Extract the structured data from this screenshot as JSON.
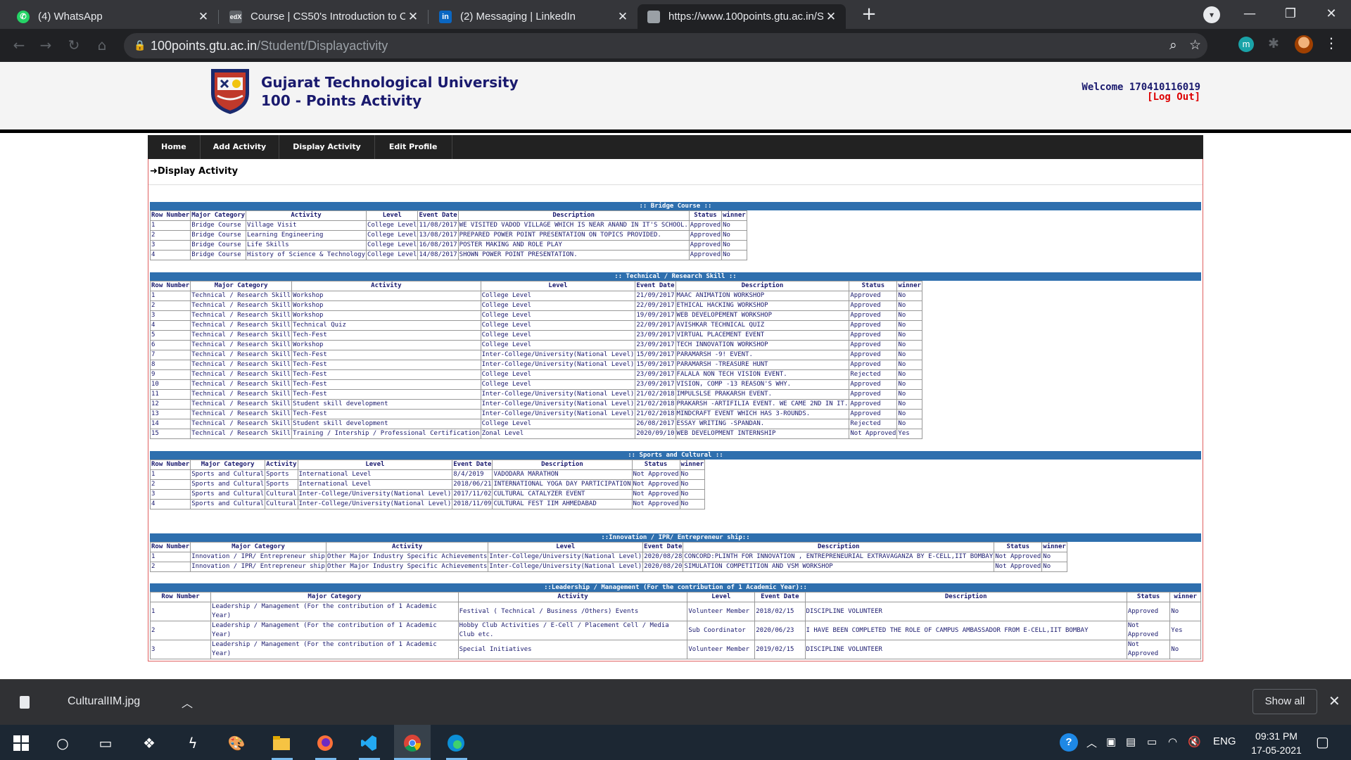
{
  "browser": {
    "tabs": [
      {
        "title": "(4) WhatsApp",
        "icon": "whatsapp-icon",
        "color": "#25d366"
      },
      {
        "title": "Course | CS50's Introduction to C",
        "icon": "edx-icon",
        "color": "#5f6368"
      },
      {
        "title": "(2) Messaging | LinkedIn",
        "icon": "linkedin-icon",
        "color": "#0a66c2"
      },
      {
        "title": "https://www.100points.gtu.ac.in/S",
        "icon": "page-icon",
        "color": "#9aa0a6"
      }
    ],
    "url_host": "100points.gtu.ac.in",
    "url_path": "/Student/Displayactivity",
    "extension_label": "m"
  },
  "header": {
    "line1": "Gujarat Technological University",
    "line2": "100 - Points Activity",
    "welcome": "Welcome 170410116019",
    "logout": "[Log Out]"
  },
  "nav": [
    "Home",
    "Add Activity",
    "Display Activity",
    "Edit Profile"
  ],
  "page_title": "➜Display Activity",
  "sections": {
    "bridge": {
      "title": ":: Bridge Course ::",
      "columns": [
        "Row Number",
        "Major Category",
        "Activity",
        "Level",
        "Event Date",
        "Description",
        "Status",
        "winner"
      ],
      "rows": [
        [
          "1",
          "Bridge Course",
          "Village Visit",
          "College Level",
          "11/08/2017",
          "WE VISITED VADOD VILLAGE WHICH IS NEAR ANAND IN IT'S SCHOOL.",
          "Approved",
          "No"
        ],
        [
          "2",
          "Bridge Course",
          "Learning Engineering",
          "College Level",
          "13/08/2017",
          "PREPARED POWER POINT PRESENTATION ON TOPICS PROVIDED.",
          "Approved",
          "No"
        ],
        [
          "3",
          "Bridge Course",
          "Life Skills",
          "College Level",
          "16/08/2017",
          "POSTER MAKING AND ROLE PLAY",
          "Approved",
          "No"
        ],
        [
          "4",
          "Bridge Course",
          "History of Science & Technology",
          "College Level",
          "14/08/2017",
          "SHOWN POWER POINT PRESENTATION.",
          "Approved",
          "No"
        ]
      ]
    },
    "technical": {
      "title": ":: Technical / Research Skill ::",
      "columns": [
        "Row Number",
        "Major Category",
        "Activity",
        "Level",
        "Event Date",
        "Description",
        "Status",
        "winner"
      ],
      "rows": [
        [
          "1",
          "Technical / Research Skill",
          "Workshop",
          "College Level",
          "21/09/2017",
          "MAAC ANIMATION WORKSHOP",
          "Approved",
          "No"
        ],
        [
          "2",
          "Technical / Research Skill",
          "Workshop",
          "College Level",
          "22/09/2017",
          "ETHICAL HACKING WORKSHOP",
          "Approved",
          "No"
        ],
        [
          "3",
          "Technical / Research Skill",
          "Workshop",
          "College Level",
          "19/09/2017",
          "WEB DEVELOPEMENT WORKSHOP",
          "Approved",
          "No"
        ],
        [
          "4",
          "Technical / Research Skill",
          "Technical Quiz",
          "College Level",
          "22/09/2017",
          "AVISHKAR TECHNICAL QUIZ",
          "Approved",
          "No"
        ],
        [
          "5",
          "Technical / Research Skill",
          "Tech-Fest",
          "College Level",
          "23/09/2017",
          "VIRTUAL PLACEMENT EVENT",
          "Approved",
          "No"
        ],
        [
          "6",
          "Technical / Research Skill",
          "Workshop",
          "College Level",
          "23/09/2017",
          "TECH INNOVATION WORKSHOP",
          "Approved",
          "No"
        ],
        [
          "7",
          "Technical / Research Skill",
          "Tech-Fest",
          "Inter-College/University(National Level)",
          "15/09/2017",
          "PARAMARSH -9! EVENT.",
          "Approved",
          "No"
        ],
        [
          "8",
          "Technical / Research Skill",
          "Tech-Fest",
          "Inter-College/University(National Level)",
          "15/09/2017",
          "PARAMARSH -TREASURE HUNT",
          "Approved",
          "No"
        ],
        [
          "9",
          "Technical / Research Skill",
          "Tech-Fest",
          "College Level",
          "23/09/2017",
          "FALALA NON TECH VISION EVENT.",
          "Rejected",
          "No"
        ],
        [
          "10",
          "Technical / Research Skill",
          "Tech-Fest",
          "College Level",
          "23/09/2017",
          "VISION, COMP -13 REASON'S WHY.",
          "Approved",
          "No"
        ],
        [
          "11",
          "Technical / Research Skill",
          "Tech-Fest",
          "Inter-College/University(National Level)",
          "21/02/2018",
          "IMPULSLSE PRAKARSH EVENT.",
          "Approved",
          "No"
        ],
        [
          "12",
          "Technical / Research Skill",
          "Student skill development",
          "Inter-College/University(National Level)",
          "21/02/2018",
          "PRAKARSH -ARTIFILIA EVENT. WE CAME 2ND IN IT.",
          "Approved",
          "No"
        ],
        [
          "13",
          "Technical / Research Skill",
          "Tech-Fest",
          "Inter-College/University(National Level)",
          "21/02/2018",
          "MINDCRAFT EVENT WHICH HAS 3-ROUNDS.",
          "Approved",
          "No"
        ],
        [
          "14",
          "Technical / Research Skill",
          "Student skill development",
          "College Level",
          "26/08/2017",
          "ESSAY WRITING -SPANDAN.",
          "Rejected",
          "No"
        ],
        [
          "15",
          "Technical / Research Skill",
          "Training / Intership / Professional Certification",
          "Zonal Level",
          "2020/09/10",
          "WEB DEVELOPMENT INTERNSHIP",
          "Not Approved",
          "Yes"
        ]
      ]
    },
    "sports": {
      "title": ":: Sports and Cultural ::",
      "columns": [
        "Row Number",
        "Major Category",
        "Activity",
        "Level",
        "Event Date",
        "Description",
        "Status",
        "winner"
      ],
      "rows": [
        [
          "1",
          "Sports and Cultural",
          "Sports",
          "International Level",
          "8/4/2019",
          "VADODARA MARATHON",
          "Not Approved",
          "No"
        ],
        [
          "2",
          "Sports and Cultural",
          "Sports",
          "International Level",
          "2018/06/21",
          "INTERNATIONAL YOGA DAY PARTICIPATION",
          "Not Approved",
          "No"
        ],
        [
          "3",
          "Sports and Cultural",
          "Cultural",
          "Inter-College/University(National Level)",
          "2017/11/02",
          "CULTURAL CATALYZER EVENT",
          "Not Approved",
          "No"
        ],
        [
          "4",
          "Sports and Cultural",
          "Cultural",
          "Inter-College/University(National Level)",
          "2018/11/09",
          "CULTURAL FEST IIM AHMEDABAD",
          "Not Approved",
          "No"
        ]
      ]
    },
    "innovation": {
      "title": "::Innovation / IPR/ Entrepreneur ship::",
      "columns": [
        "Row Number",
        "Major Category",
        "Activity",
        "Level",
        "Event Date",
        "Description",
        "Status",
        "winner"
      ],
      "rows": [
        [
          "1",
          "Innovation / IPR/ Entrepreneur ship",
          "Other Major Industry Specific Achievements",
          "Inter-College/University(National Level)",
          "2020/08/28",
          "CONCORD:PLINTH FOR INNOVATION , ENTREPRENEURIAL EXTRAVAGANZA BY E-CELL,IIT BOMBAY",
          "Not Approved",
          "No"
        ],
        [
          "2",
          "Innovation / IPR/ Entrepreneur ship",
          "Other Major Industry Specific Achievements",
          "Inter-College/University(National Level)",
          "2020/08/20",
          "SIMULATION COMPETITION AND VSM WORKSHOP",
          "Not Approved",
          "No"
        ]
      ]
    },
    "leadership": {
      "title": "::Leadership / Management (For the contribution of 1 Academic Year)::",
      "columns": [
        "Row Number",
        "Major Category",
        "Activity",
        "Level",
        "Event Date",
        "Description",
        "Status",
        "winner"
      ],
      "rows": [
        [
          "1",
          "Leadership / Management (For the contribution of 1 Academic Year)",
          "Festival ( Technical / Business /Others) Events",
          "Volunteer Member",
          "2018/02/15",
          "DISCIPLINE VOLUNTEER",
          "Approved",
          "No"
        ],
        [
          "2",
          "Leadership / Management (For the contribution of 1 Academic Year)",
          "Hobby Club Activities / E-Cell / Placement Cell / Media Club etc.",
          "Sub Coordinator",
          "2020/06/23",
          "I HAVE BEEN COMPLETED THE ROLE OF CAMPUS AMBASSADOR FROM E-CELL,IIT BOMBAY",
          "Not Approved",
          "Yes"
        ],
        [
          "3",
          "Leadership / Management (For the contribution of 1 Academic Year)",
          "Special Initiatives",
          "Volunteer Member",
          "2019/02/15",
          "DISCIPLINE VOLUNTEER",
          "Not Approved",
          "No"
        ]
      ]
    }
  },
  "download": {
    "file": "CulturalIIM.jpg",
    "show_all": "Show all"
  },
  "taskbar": {
    "lang": "ENG",
    "time": "09:31 PM",
    "date": "17-05-2021"
  }
}
